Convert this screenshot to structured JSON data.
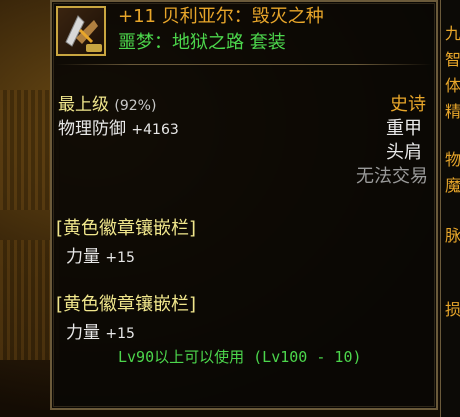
{
  "item": {
    "name": "+11 贝利亚尔：毁灭之种",
    "set": "噩梦：地狱之路  套装",
    "grade": "最上级",
    "grade_pct": "(92%)",
    "rarity": "史诗",
    "defense_label": "物理防御",
    "defense_value": "+4163",
    "armor_type": "重甲",
    "slot": "头肩",
    "tradable": "无法交易",
    "sockets": [
      {
        "label": "[黄色徽章镶嵌栏]",
        "stat": "力量",
        "value": "+15"
      },
      {
        "label": "[黄色徽章镶嵌栏]",
        "stat": "力量",
        "value": "+15"
      }
    ],
    "requirement": "Lv90以上可以使用 (Lv100 - 10)"
  },
  "side_panel": {
    "chars": [
      "九",
      "智",
      "体",
      "精",
      "物",
      "魔",
      "脉",
      "损"
    ]
  },
  "colors": {
    "name": "#e8a62a",
    "set": "#4cd64c",
    "border": "#6b5a3a"
  }
}
